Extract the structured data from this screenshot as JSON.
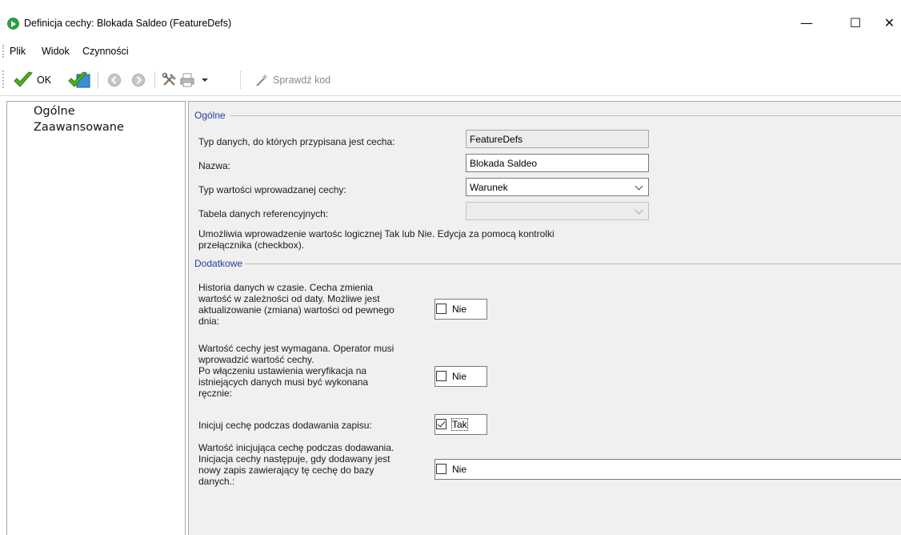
{
  "window": {
    "title": "Definicja cechy: Blokada Saldeo (FeatureDefs)",
    "minimize": "—",
    "maximize": "☐",
    "close": "✕"
  },
  "menu": [
    "Plik",
    "Widok",
    "Czynności"
  ],
  "toolbar": {
    "ok_label": "OK",
    "check_code_label": "Sprawdź kod"
  },
  "nav": {
    "items": [
      "Ogólne",
      "Zaawansowane"
    ]
  },
  "general": {
    "legend": "Ogólne",
    "data_type_label": "Typ danych, do których przypisana jest cecha:",
    "data_type_value": "FeatureDefs",
    "name_label": "Nazwa:",
    "name_value": "Blokada Saldeo",
    "value_type_label": "Typ wartości wprowadzanej cechy:",
    "value_type_value": "Warunek",
    "ref_table_label": "Tabela danych referencyjnych:",
    "ref_table_value": "",
    "description_line1": "Umożliwia wprowadzenie wartośc logicznej Tak lub Nie. Edycja za pomocą kontrolki",
    "description_line2": "przełącznika (checkbox)."
  },
  "additional": {
    "legend": "Dodatkowe",
    "history": {
      "lines": [
        "Historia danych w czasie. Cecha zmienia",
        "wartość w zależności od daty. Możliwe jest",
        "aktualizowanie (zmiana) wartości od pewnego",
        "dnia:"
      ],
      "value": "Nie",
      "checked": false
    },
    "required": {
      "lines": [
        "Wartość cechy jest wymagana. Operator musi",
        "wprowadzić wartość cechy.",
        "Po włączeniu ustawienia weryfikacja na",
        "istniejących danych musi być wykonana",
        "ręcznie:"
      ],
      "value": "Nie",
      "checked": false
    },
    "init_on_add": {
      "lines": [
        "Inicjuj cechę podczas dodawania zapisu:"
      ],
      "value": "Tak",
      "checked": true
    },
    "init_value": {
      "lines": [
        "Wartość inicjująca cechę podczas dodawania.",
        "Inicjacja cechy następuje, gdy dodawany jest",
        "nowy zapis zawierający tę cechę do bazy",
        "danych.:"
      ],
      "value": "Nie",
      "checked": false
    }
  }
}
